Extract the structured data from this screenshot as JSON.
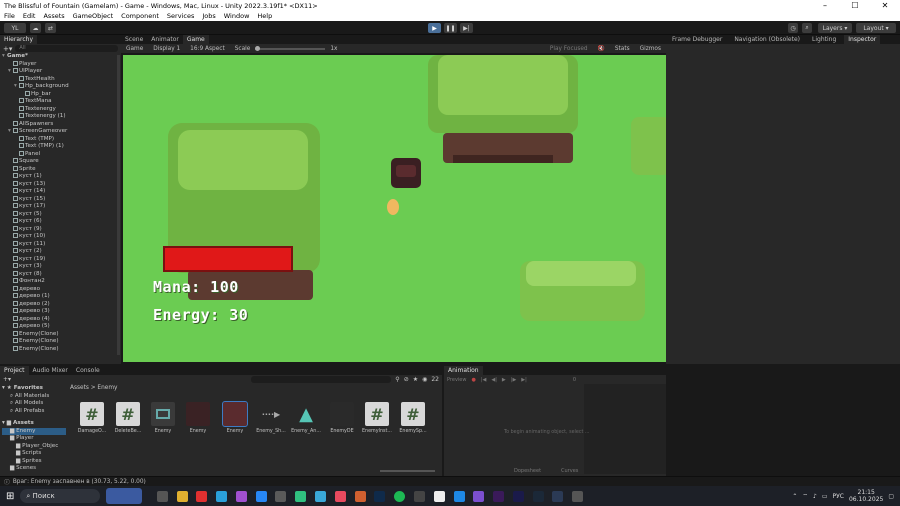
{
  "window": {
    "title": "The Blissful of Fountain (Gamelam) - Game - Windows, Mac, Linux - Unity 2022.3.19f1* <DX11>"
  },
  "menu": [
    "File",
    "Edit",
    "Assets",
    "GameObject",
    "Component",
    "Services",
    "Jobs",
    "Window",
    "Help"
  ],
  "toolbar": {
    "account": "YL",
    "layers": "Layers",
    "layout": "Layout"
  },
  "hierarchy": {
    "tab": "Hierarchy",
    "search_placeholder": "All",
    "items": [
      "Game*",
      "Player",
      "UIPlayer",
      "TextHealth",
      "Hp_background",
      "Hp_bar",
      "TextMana",
      "Textenergy",
      "Textenergy (1)",
      "AllSpawners",
      "ScreenGameover",
      "Text (TMP)",
      "Text (TMP) (1)",
      "Panel",
      "Square",
      "Sprite",
      "куст (1)",
      "куст (13)",
      "куст (14)",
      "куст (15)",
      "куст (17)",
      "куст (5)",
      "куст (6)",
      "куст (9)",
      "куст (10)",
      "куст (11)",
      "куст (2)",
      "куст (19)",
      "куст (3)",
      "куст (8)",
      "Фонтан2",
      "дерево",
      "дерево (1)",
      "дерево (2)",
      "дерево (3)",
      "дерево (4)",
      "дерево (5)",
      "Enemy(Clone)",
      "Enemy(Clone)",
      "Enemy(Clone)"
    ]
  },
  "scene_tabs": [
    "Scene",
    "Animator",
    "Game"
  ],
  "gamebar": {
    "mode": "Game",
    "display": "Display 1",
    "aspect": "16:9 Aspect",
    "scale_label": "Scale",
    "scale_value": "1x",
    "play_focused": "Play Focused",
    "stats": "Stats",
    "gizmos": "Gizmos"
  },
  "right_tabs": [
    "Frame Debugger",
    "Navigation (Obsolete)",
    "Lighting",
    "Inspector"
  ],
  "game": {
    "mana_text": "Mana: 100",
    "energy_text": "Energy: 30",
    "hp_fill": 1.0
  },
  "project": {
    "tabs": [
      "Project",
      "Audio Mixer",
      "Console"
    ],
    "favorites_label": "Favorites",
    "favorites": [
      "All Materials",
      "All Models",
      "All Prefabs"
    ],
    "assets_label": "Assets",
    "tree": [
      "Enemy",
      "Player",
      "Player_Objec",
      "Scripts",
      "Sprites",
      "Scenes"
    ],
    "breadcrumb": [
      "Assets",
      "Enemy"
    ],
    "item_count": "22",
    "assets": [
      "DamageO...",
      "DeleteBe...",
      "Enemy",
      "Enemy",
      "Enemy",
      "Enemy_Sh...",
      "Enemy_An...",
      "EnemyDE",
      "EnemyInst...",
      "EnemySp..."
    ]
  },
  "animation": {
    "tab": "Animation",
    "preview": "Preview",
    "frame": "0",
    "empty_msg": "To begin animating object, select ...",
    "dopesheet": "Dopesheet",
    "curves": "Curves"
  },
  "status": {
    "text": "Враг: Enemy заспавнен в (30.73, 5.22, 0.00)"
  },
  "taskbar": {
    "search": "Поиск",
    "lang": "РУС",
    "time": "21:15",
    "date": "06.10.2025"
  },
  "colors": {
    "accent": "#4a6f99",
    "grass": "#6bcc52",
    "editor_bg": "#282828"
  }
}
